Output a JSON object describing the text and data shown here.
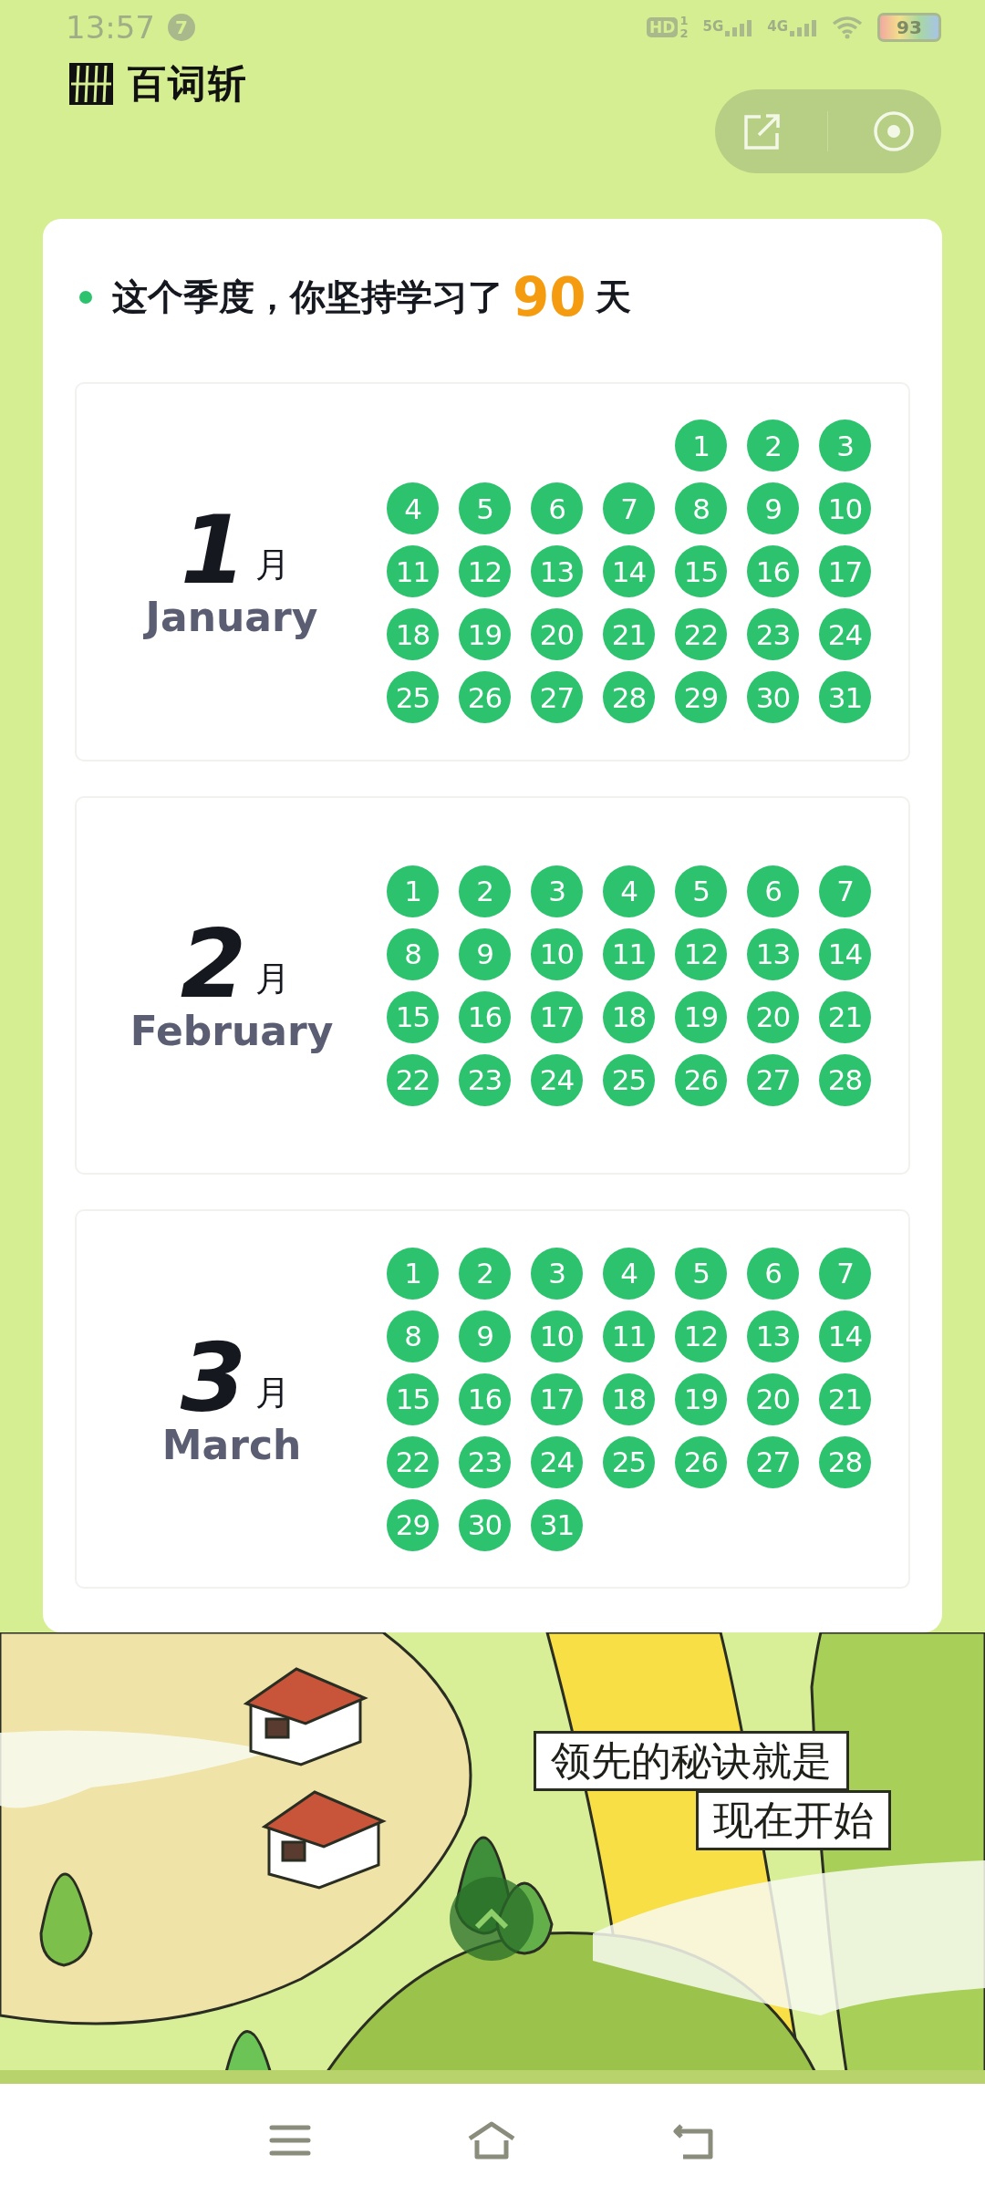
{
  "status_bar": {
    "time": "13:57",
    "notification_count": "7",
    "hd_label": "HD",
    "sim_labels": [
      "1",
      "2"
    ],
    "network_labels": [
      "5G",
      "4G"
    ],
    "battery": "93"
  },
  "header": {
    "app_name": "百词斩"
  },
  "summary": {
    "prefix": "这个季度，你坚持学习了",
    "count": "90",
    "suffix": "天"
  },
  "months": [
    {
      "number": "1",
      "unit": "月",
      "name": "January",
      "days": [
        {
          "kind": "blank"
        },
        {
          "kind": "blank"
        },
        {
          "kind": "blank"
        },
        {
          "kind": "blank"
        },
        {
          "kind": "day",
          "label": "1",
          "studied": true
        },
        {
          "kind": "day",
          "label": "2",
          "studied": true
        },
        {
          "kind": "day",
          "label": "3",
          "studied": true
        },
        {
          "kind": "day",
          "label": "4",
          "studied": true
        },
        {
          "kind": "day",
          "label": "5",
          "studied": true
        },
        {
          "kind": "day",
          "label": "6",
          "studied": true
        },
        {
          "kind": "day",
          "label": "7",
          "studied": true
        },
        {
          "kind": "day",
          "label": "8",
          "studied": true
        },
        {
          "kind": "day",
          "label": "9",
          "studied": true
        },
        {
          "kind": "day",
          "label": "10",
          "studied": true
        },
        {
          "kind": "day",
          "label": "11",
          "studied": true
        },
        {
          "kind": "day",
          "label": "12",
          "studied": true
        },
        {
          "kind": "day",
          "label": "13",
          "studied": true
        },
        {
          "kind": "day",
          "label": "14",
          "studied": true
        },
        {
          "kind": "day",
          "label": "15",
          "studied": true
        },
        {
          "kind": "day",
          "label": "16",
          "studied": true
        },
        {
          "kind": "day",
          "label": "17",
          "studied": true
        },
        {
          "kind": "day",
          "label": "18",
          "studied": true
        },
        {
          "kind": "day",
          "label": "19",
          "studied": true
        },
        {
          "kind": "day",
          "label": "20",
          "studied": true
        },
        {
          "kind": "day",
          "label": "21",
          "studied": true
        },
        {
          "kind": "day",
          "label": "22",
          "studied": true
        },
        {
          "kind": "day",
          "label": "23",
          "studied": true
        },
        {
          "kind": "day",
          "label": "24",
          "studied": true
        },
        {
          "kind": "day",
          "label": "25",
          "studied": true
        },
        {
          "kind": "day",
          "label": "26",
          "studied": true
        },
        {
          "kind": "day",
          "label": "27",
          "studied": true
        },
        {
          "kind": "day",
          "label": "28",
          "studied": true
        },
        {
          "kind": "day",
          "label": "29",
          "studied": true
        },
        {
          "kind": "day",
          "label": "30",
          "studied": true
        },
        {
          "kind": "day",
          "label": "31",
          "studied": true
        }
      ]
    },
    {
      "number": "2",
      "unit": "月",
      "name": "February",
      "days": [
        {
          "kind": "day",
          "label": "1",
          "studied": true
        },
        {
          "kind": "day",
          "label": "2",
          "studied": true
        },
        {
          "kind": "day",
          "label": "3",
          "studied": true
        },
        {
          "kind": "day",
          "label": "4",
          "studied": true
        },
        {
          "kind": "day",
          "label": "5",
          "studied": true
        },
        {
          "kind": "day",
          "label": "6",
          "studied": true
        },
        {
          "kind": "day",
          "label": "7",
          "studied": true
        },
        {
          "kind": "day",
          "label": "8",
          "studied": true
        },
        {
          "kind": "day",
          "label": "9",
          "studied": true
        },
        {
          "kind": "day",
          "label": "10",
          "studied": true
        },
        {
          "kind": "day",
          "label": "11",
          "studied": true
        },
        {
          "kind": "day",
          "label": "12",
          "studied": true
        },
        {
          "kind": "day",
          "label": "13",
          "studied": true
        },
        {
          "kind": "day",
          "label": "14",
          "studied": true
        },
        {
          "kind": "day",
          "label": "15",
          "studied": true
        },
        {
          "kind": "day",
          "label": "16",
          "studied": true
        },
        {
          "kind": "day",
          "label": "17",
          "studied": true
        },
        {
          "kind": "day",
          "label": "18",
          "studied": true
        },
        {
          "kind": "day",
          "label": "19",
          "studied": true
        },
        {
          "kind": "day",
          "label": "20",
          "studied": true
        },
        {
          "kind": "day",
          "label": "21",
          "studied": true
        },
        {
          "kind": "day",
          "label": "22",
          "studied": true
        },
        {
          "kind": "day",
          "label": "23",
          "studied": true
        },
        {
          "kind": "day",
          "label": "24",
          "studied": true
        },
        {
          "kind": "day",
          "label": "25",
          "studied": true
        },
        {
          "kind": "day",
          "label": "26",
          "studied": true
        },
        {
          "kind": "day",
          "label": "27",
          "studied": true
        },
        {
          "kind": "day",
          "label": "28",
          "studied": true
        }
      ]
    },
    {
      "number": "3",
      "unit": "月",
      "name": "March",
      "days": [
        {
          "kind": "day",
          "label": "1",
          "studied": true
        },
        {
          "kind": "day",
          "label": "2",
          "studied": true
        },
        {
          "kind": "day",
          "label": "3",
          "studied": true
        },
        {
          "kind": "day",
          "label": "4",
          "studied": true
        },
        {
          "kind": "day",
          "label": "5",
          "studied": true
        },
        {
          "kind": "day",
          "label": "6",
          "studied": true
        },
        {
          "kind": "day",
          "label": "7",
          "studied": true
        },
        {
          "kind": "day",
          "label": "8",
          "studied": true
        },
        {
          "kind": "day",
          "label": "9",
          "studied": true
        },
        {
          "kind": "day",
          "label": "10",
          "studied": true
        },
        {
          "kind": "day",
          "label": "11",
          "studied": true
        },
        {
          "kind": "day",
          "label": "12",
          "studied": true
        },
        {
          "kind": "day",
          "label": "13",
          "studied": true
        },
        {
          "kind": "day",
          "label": "14",
          "studied": true
        },
        {
          "kind": "day",
          "label": "15",
          "studied": true
        },
        {
          "kind": "day",
          "label": "16",
          "studied": true
        },
        {
          "kind": "day",
          "label": "17",
          "studied": true
        },
        {
          "kind": "day",
          "label": "18",
          "studied": true
        },
        {
          "kind": "day",
          "label": "19",
          "studied": true
        },
        {
          "kind": "day",
          "label": "20",
          "studied": true
        },
        {
          "kind": "day",
          "label": "21",
          "studied": true
        },
        {
          "kind": "day",
          "label": "22",
          "studied": true
        },
        {
          "kind": "day",
          "label": "23",
          "studied": true
        },
        {
          "kind": "day",
          "label": "24",
          "studied": true
        },
        {
          "kind": "day",
          "label": "25",
          "studied": true
        },
        {
          "kind": "day",
          "label": "26",
          "studied": true
        },
        {
          "kind": "day",
          "label": "27",
          "studied": true
        },
        {
          "kind": "day",
          "label": "28",
          "studied": true
        },
        {
          "kind": "day",
          "label": "29",
          "studied": true
        },
        {
          "kind": "day",
          "label": "30",
          "studied": true
        },
        {
          "kind": "day",
          "label": "31",
          "studied": true
        }
      ]
    }
  ],
  "slogan": {
    "lines": [
      "领先的秘诀就是",
      "现在开始"
    ]
  }
}
